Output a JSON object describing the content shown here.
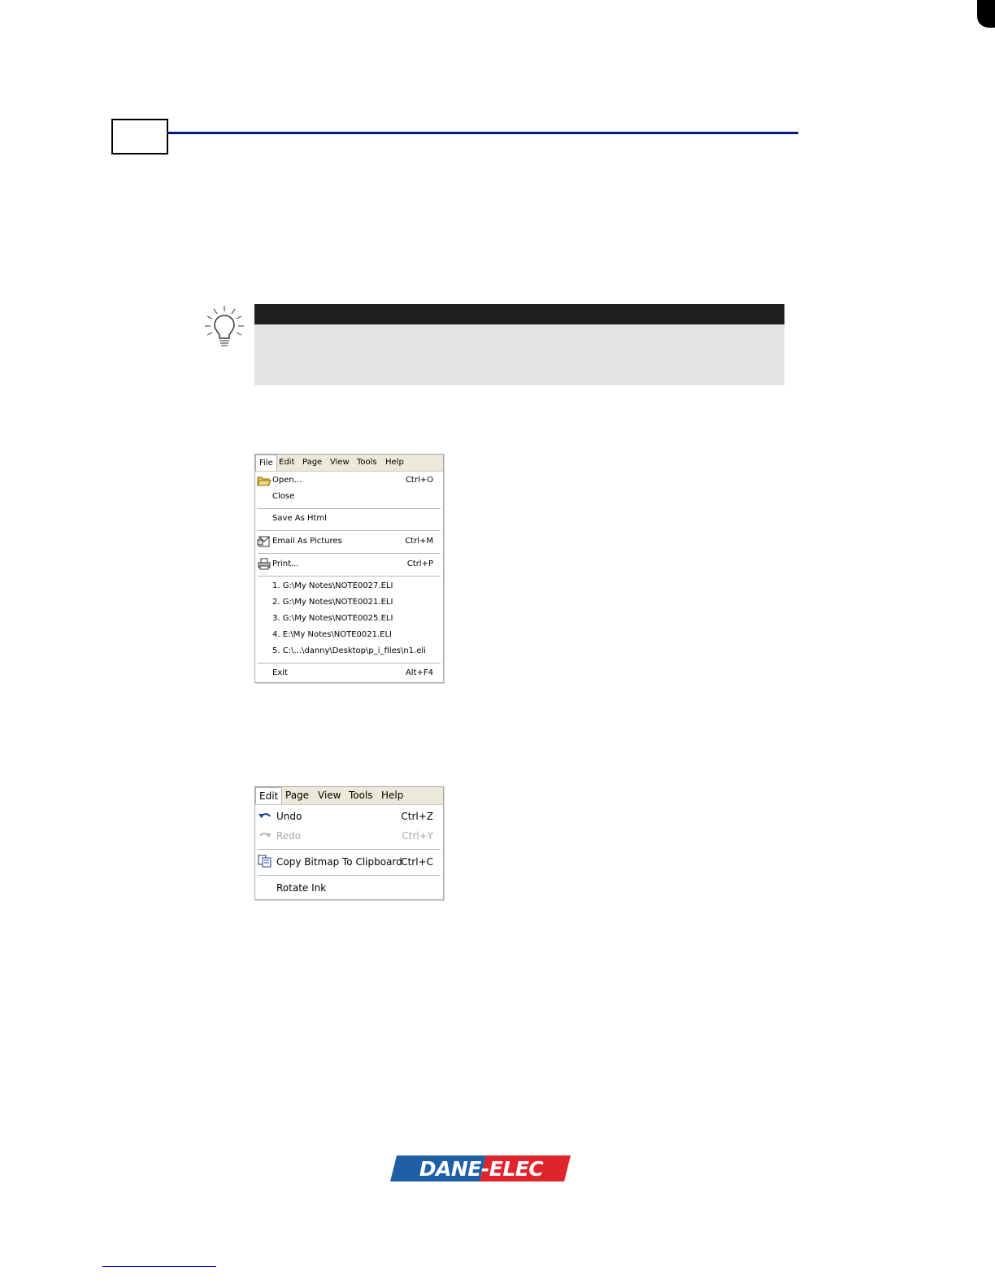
{
  "file_menu": {
    "menubar": [
      "File",
      "Edit",
      "Page",
      "View",
      "Tools",
      "Help"
    ],
    "items": [
      {
        "label": "Open...",
        "shortcut": "Ctrl+O",
        "icon": "open-folder-icon"
      },
      {
        "label": "Close",
        "shortcut": ""
      },
      {
        "label": "Save As Html",
        "shortcut": ""
      },
      {
        "label": "Email As Pictures",
        "shortcut": "Ctrl+M",
        "icon": "email-icon"
      },
      {
        "label": "Print...",
        "shortcut": "Ctrl+P",
        "icon": "printer-icon"
      },
      {
        "label": "1. G:\\My Notes\\NOTE0027.ELI",
        "shortcut": ""
      },
      {
        "label": "2. G:\\My Notes\\NOTE0021.ELI",
        "shortcut": ""
      },
      {
        "label": "3. G:\\My Notes\\NOTE0025.ELI",
        "shortcut": ""
      },
      {
        "label": "4. E:\\My Notes\\NOTE0021.ELI",
        "shortcut": ""
      },
      {
        "label": "5. C:\\...\\danny\\Desktop\\p_i_files\\n1.eli",
        "shortcut": ""
      },
      {
        "label": "Exit",
        "shortcut": "Alt+F4"
      }
    ]
  },
  "edit_menu": {
    "menubar": [
      "Edit",
      "Page",
      "View",
      "Tools",
      "Help"
    ],
    "items": [
      {
        "label": "Undo",
        "shortcut": "Ctrl+Z",
        "icon": "undo-icon",
        "enabled": true
      },
      {
        "label": "Redo",
        "shortcut": "Ctrl+Y",
        "icon": "redo-icon",
        "enabled": false
      },
      {
        "label": "Copy Bitmap To Clipboard",
        "shortcut": "Ctrl+C",
        "icon": "copy-icon",
        "enabled": true
      },
      {
        "label": "Rotate Ink",
        "shortcut": "",
        "enabled": true
      }
    ]
  },
  "logo": {
    "text": "DANE-ELEC",
    "colors": {
      "blue": "#1f5fa8",
      "red": "#e0242b"
    }
  },
  "colors": {
    "header_rule": "#0b1a78",
    "tip_bar": "#1e1e1e",
    "tip_body": "#e4e4e4",
    "menubar": "#ece9d8"
  }
}
